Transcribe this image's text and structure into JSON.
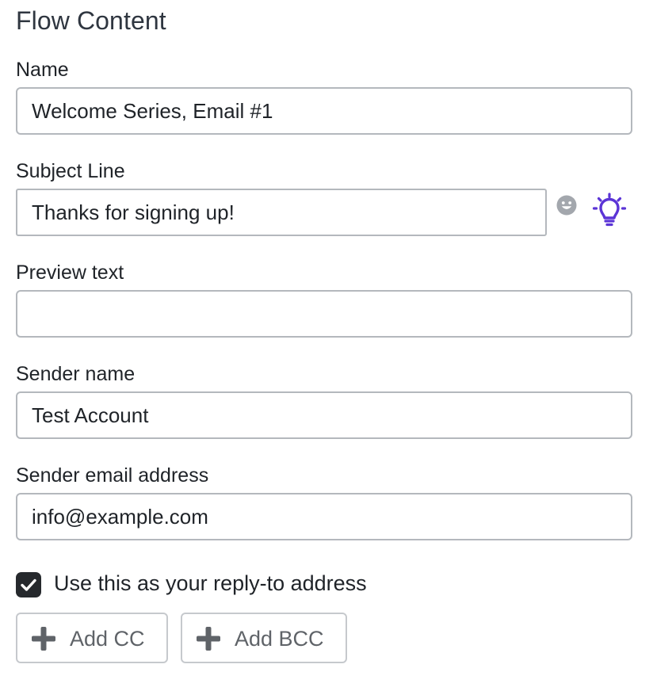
{
  "panel": {
    "title": "Flow Content"
  },
  "fields": {
    "name": {
      "label": "Name",
      "value": "Welcome Series, Email #1"
    },
    "subject": {
      "label": "Subject Line",
      "value": "Thanks for signing up!"
    },
    "preview": {
      "label": "Preview text",
      "value": ""
    },
    "sender_name": {
      "label": "Sender name",
      "value": "Test Account"
    },
    "sender_email": {
      "label": "Sender email address",
      "value": "info@example.com"
    }
  },
  "icons": {
    "emoji": "smiley-face-icon",
    "suggestions": "lightbulb-icon",
    "checkbox": "checkmark-icon",
    "add": "plus-icon"
  },
  "reply_to": {
    "checked": true,
    "label": "Use this as your reply-to address"
  },
  "buttons": {
    "add_cc": "Add CC",
    "add_bcc": "Add BCC"
  },
  "colors": {
    "accent_purple": "#5b34d6",
    "checkbox_fill": "#26292d",
    "field_border": "#b4b8bd",
    "muted_text": "#5f6368"
  }
}
